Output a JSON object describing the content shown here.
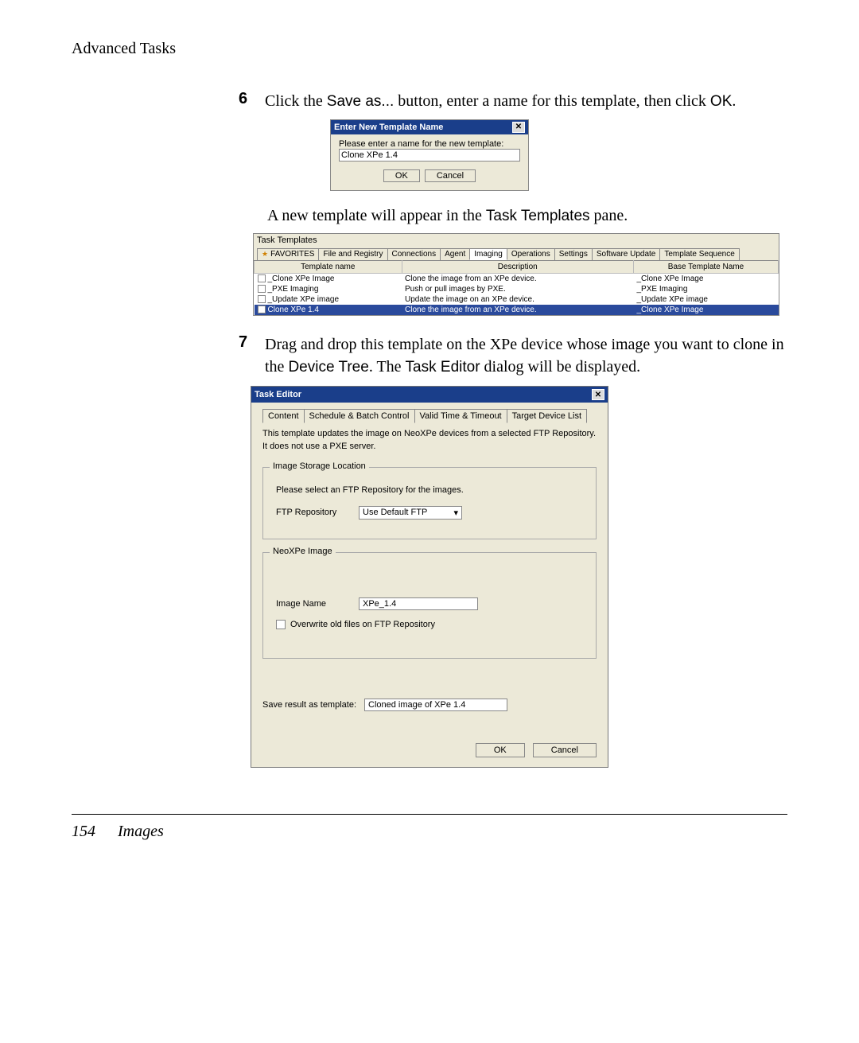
{
  "header": {
    "title": "Advanced Tasks"
  },
  "step6": {
    "num": "6",
    "text_a": "Click the ",
    "saveas": "Save as...",
    "text_b": " button, enter a name for this template, then click ",
    "ok": "OK",
    "text_c": "."
  },
  "dlg1": {
    "title": "Enter New Template Name",
    "prompt": "Please enter a name for the new template:",
    "value": "Clone XPe 1.4",
    "ok": "OK",
    "cancel": "Cancel"
  },
  "para1": {
    "text_a": "A new template will appear in the ",
    "code": "Task Templates",
    "text_b": " pane."
  },
  "tt": {
    "title": "Task Templates",
    "tabs": {
      "favorites": "FAVORITES",
      "file": "File and Registry",
      "connections": "Connections",
      "agent": "Agent",
      "imaging": "Imaging",
      "operations": "Operations",
      "settings": "Settings",
      "software": "Software Update",
      "sequence": "Template Sequence"
    },
    "columns": {
      "name": "Template name",
      "desc": "Description",
      "base": "Base Template Name"
    },
    "rows": [
      {
        "name": "_Clone XPe Image",
        "desc": "Clone the image from an XPe device.",
        "base": "_Clone XPe Image"
      },
      {
        "name": "_PXE Imaging",
        "desc": "Push or pull images by PXE.",
        "base": "_PXE Imaging"
      },
      {
        "name": "_Update XPe image",
        "desc": "Update the image on an XPe device.",
        "base": "_Update XPe image"
      },
      {
        "name": "Clone XPe 1.4",
        "desc": "Clone the image from an XPe device.",
        "base": "_Clone XPe Image"
      }
    ]
  },
  "step7": {
    "num": "7",
    "text_a": "Drag and drop this template on the XPe device whose image you want to clone in the ",
    "code1": "Device Tree",
    "text_b": ". The ",
    "code2": "Task Editor",
    "text_c": " dialog will be displayed."
  },
  "te": {
    "title": "Task Editor",
    "tabs": {
      "content": "Content",
      "schedule": "Schedule & Batch Control",
      "valid": "Valid Time & Timeout",
      "target": "Target Device List"
    },
    "desc": "This template updates the image on NeoXPe devices from a selected FTP Repository. It does not use a PXE server.",
    "storage_legend": "Image Storage Location",
    "storage_prompt": "Please select an FTP Repository for the images.",
    "ftp_label": "FTP Repository",
    "ftp_value": "Use Default FTP",
    "image_legend": "NeoXPe Image",
    "image_label": "Image Name",
    "image_value": "XPe_1.4",
    "overwrite_label": "Overwrite old files on FTP Repository",
    "save_label": "Save result as template:",
    "save_value": "Cloned image of XPe 1.4",
    "ok": "OK",
    "cancel": "Cancel"
  },
  "footer": {
    "page": "154",
    "section": "Images"
  }
}
